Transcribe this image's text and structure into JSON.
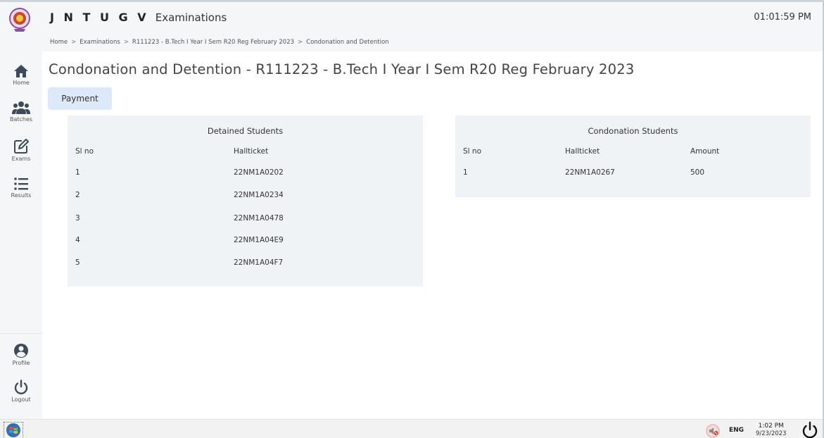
{
  "header": {
    "brand": "J N T U G V",
    "brand_sub": "Examinations",
    "clock": "01:01:59 PM"
  },
  "breadcrumb": [
    "Home",
    "Examinations",
    "R111223 - B.Tech I Year I Sem R20 Reg February 2023",
    "Condonation and Detention"
  ],
  "sidebar": {
    "items": [
      {
        "label": "Home",
        "icon": "home-icon"
      },
      {
        "label": "Batches",
        "icon": "users-icon"
      },
      {
        "label": "Exams",
        "icon": "edit-icon"
      },
      {
        "label": "Results",
        "icon": "list-icon"
      }
    ],
    "bottom": [
      {
        "label": "Profile",
        "icon": "user-circle-icon"
      },
      {
        "label": "Logout",
        "icon": "power-icon"
      }
    ]
  },
  "page": {
    "title": "Condonation and Detention - R111223 - B.Tech I Year I Sem R20 Reg February 2023",
    "payment_button": "Payment"
  },
  "detained": {
    "title": "Detained Students",
    "columns": [
      "Sl no",
      "Hallticket"
    ],
    "rows": [
      {
        "sl": "1",
        "hallticket": "22NM1A0202"
      },
      {
        "sl": "2",
        "hallticket": "22NM1A0234"
      },
      {
        "sl": "3",
        "hallticket": "22NM1A0478"
      },
      {
        "sl": "4",
        "hallticket": "22NM1A04E9"
      },
      {
        "sl": "5",
        "hallticket": "22NM1A04F7"
      }
    ]
  },
  "condonation": {
    "title": "Condonation Students",
    "columns": [
      "Sl no",
      "Hallticket",
      "Amount"
    ],
    "rows": [
      {
        "sl": "1",
        "hallticket": "22NM1A0267",
        "amount": "500"
      }
    ]
  },
  "taskbar": {
    "language": "ENG",
    "time": "1:02 PM",
    "date": "9/23/2023"
  },
  "colors": {
    "accent_button": "#dde9f9",
    "panel_bg": "#f0f3f6",
    "chrome_bg": "#f5f6f7"
  }
}
